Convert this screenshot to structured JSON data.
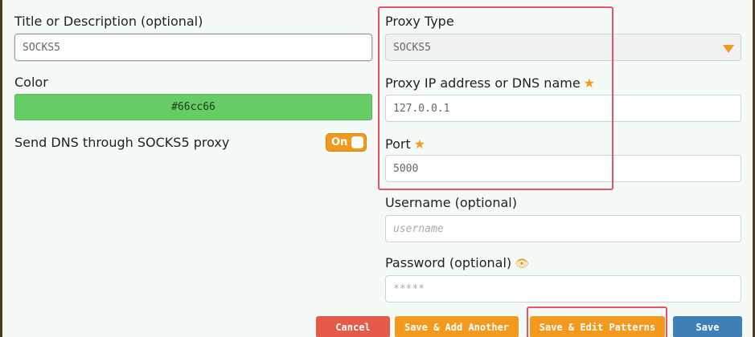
{
  "left": {
    "title_label": "Title or Description (optional)",
    "title_value": "SOCKS5",
    "color_label": "Color",
    "color_value": "#66cc66",
    "dns_label": "Send DNS through SOCKS5 proxy",
    "dns_toggle": "On"
  },
  "right": {
    "proxy_type_label": "Proxy Type",
    "proxy_type_value": "SOCKS5",
    "ip_label": "Proxy IP address or DNS name",
    "ip_value": "127.0.0.1",
    "port_label": "Port",
    "port_value": "5000",
    "username_label": "Username (optional)",
    "username_placeholder": "username",
    "password_label": "Password (optional)",
    "password_placeholder": "*****"
  },
  "buttons": {
    "cancel": "Cancel",
    "save_add": "Save & Add Another",
    "save_edit": "Save & Edit Patterns",
    "save": "Save"
  },
  "icons": {
    "required": "star-icon",
    "show_password": "eye-icon",
    "dropdown": "caret-down-icon"
  },
  "colors": {
    "accent": "#f39a1e",
    "highlight": "#e8536a",
    "color_swatch": "#66cc66",
    "cancel": "#e65a4a",
    "save": "#3f7fb8"
  }
}
